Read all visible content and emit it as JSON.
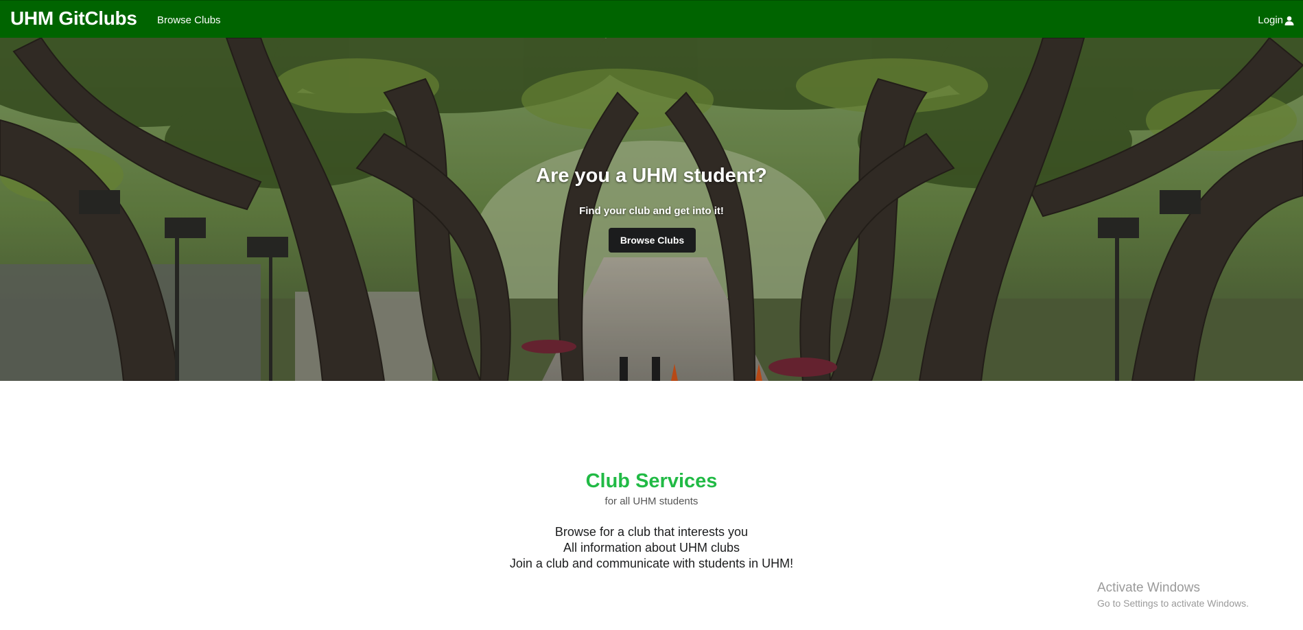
{
  "navbar": {
    "brand": "UHM GitClubs",
    "browse_link": "Browse Clubs",
    "login_label": "Login",
    "background_color": "#006400",
    "login_icon": "user-icon"
  },
  "hero": {
    "title": "Are you a UHM student?",
    "subtitle": "Find your club and get into it!",
    "button_label": "Browse Clubs",
    "background_image": "campus-tree-canopy-walkway"
  },
  "services": {
    "title": "Club Services",
    "subtitle": "for all UHM students",
    "lines": [
      "Browse for a club that interests you",
      "All information about UHM clubs",
      "Join a club and communicate with students in UHM!"
    ],
    "title_color": "#21ba45"
  },
  "os_watermark": {
    "line1": "Activate Windows",
    "line2": "Go to Settings to activate Windows."
  }
}
